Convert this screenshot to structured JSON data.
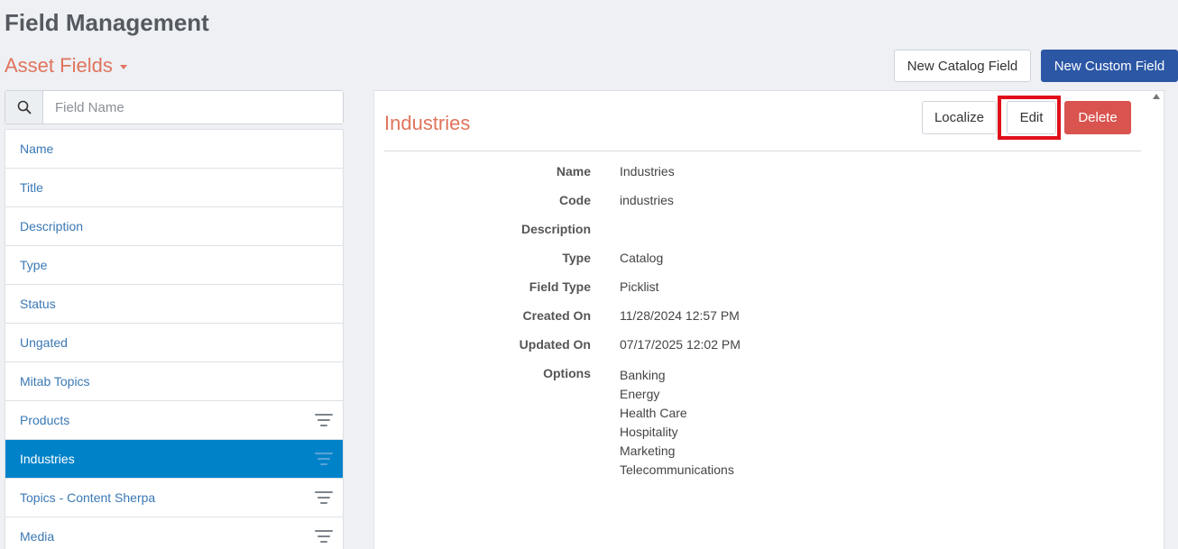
{
  "header": {
    "title": "Field Management",
    "section": "Asset Fields",
    "new_catalog_label": "New Catalog Field",
    "new_custom_label": "New Custom Field"
  },
  "search": {
    "placeholder": "Field Name",
    "value": ""
  },
  "fields": [
    {
      "label": "Name",
      "filterable": false,
      "active": false
    },
    {
      "label": "Title",
      "filterable": false,
      "active": false
    },
    {
      "label": "Description",
      "filterable": false,
      "active": false
    },
    {
      "label": "Type",
      "filterable": false,
      "active": false
    },
    {
      "label": "Status",
      "filterable": false,
      "active": false
    },
    {
      "label": "Ungated",
      "filterable": false,
      "active": false
    },
    {
      "label": "Mitab Topics",
      "filterable": false,
      "active": false
    },
    {
      "label": "Products",
      "filterable": true,
      "active": false
    },
    {
      "label": "Industries",
      "filterable": true,
      "active": true
    },
    {
      "label": "Topics - Content Sherpa",
      "filterable": true,
      "active": false
    },
    {
      "label": "Media",
      "filterable": true,
      "active": false
    }
  ],
  "detail": {
    "title": "Industries",
    "localize_label": "Localize",
    "edit_label": "Edit",
    "delete_label": "Delete",
    "properties": [
      {
        "label": "Name",
        "value": "Industries"
      },
      {
        "label": "Code",
        "value": "industries"
      },
      {
        "label": "Description",
        "value": ""
      },
      {
        "label": "Type",
        "value": "Catalog"
      },
      {
        "label": "Field Type",
        "value": "Picklist"
      },
      {
        "label": "Created On",
        "value": "11/28/2024 12:57 PM"
      },
      {
        "label": "Updated On",
        "value": "07/17/2025 12:02 PM"
      }
    ],
    "options_label": "Options",
    "options": [
      "Banking",
      "Energy",
      "Health Care",
      "Hospitality",
      "Marketing",
      "Telecommunications"
    ]
  },
  "colors": {
    "accent": "#e0745c",
    "primary": "#2b57a5",
    "active": "#0082c9",
    "danger": "#d9534f",
    "highlight": "#e0101a"
  },
  "icons": {
    "search": "search-icon",
    "filter": "filter-icon",
    "caret": "caret-down-icon"
  }
}
